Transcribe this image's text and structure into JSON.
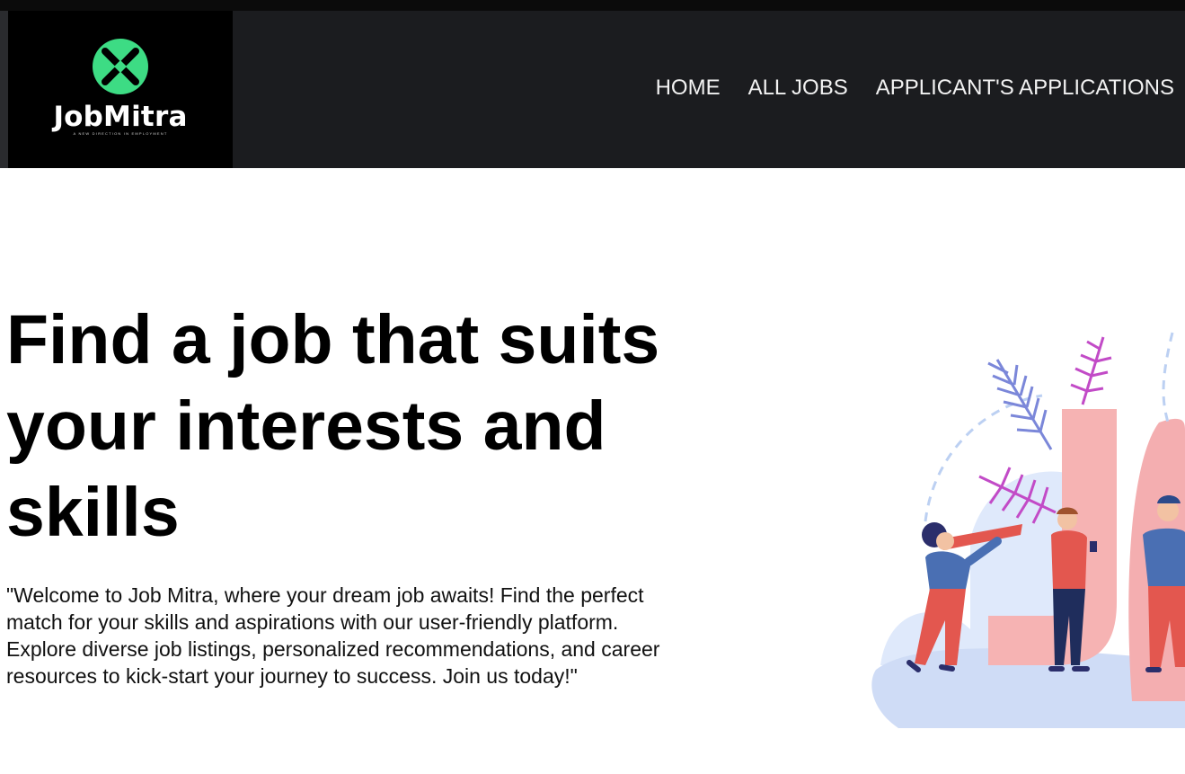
{
  "brand": {
    "name": "JobMitra",
    "tagline": "A NEW DIRECTION IN EMPLOYMENT",
    "accent": "#3ddc84"
  },
  "nav": {
    "items": [
      {
        "label": "HOME"
      },
      {
        "label": "ALL JOBS"
      },
      {
        "label": "APPLICANT'S APPLICATIONS"
      }
    ]
  },
  "hero": {
    "title": "Find a job that suits your interests and skills",
    "description": "\"Welcome to Job Mitra, where your dream job awaits! Find the perfect match for your skills and aspirations with our user-friendly platform. Explore diverse job listings, personalized recommendations, and career resources to kick-start your journey to success. Join us today!\""
  },
  "illustration": {
    "icon": "job-search-illustration"
  }
}
